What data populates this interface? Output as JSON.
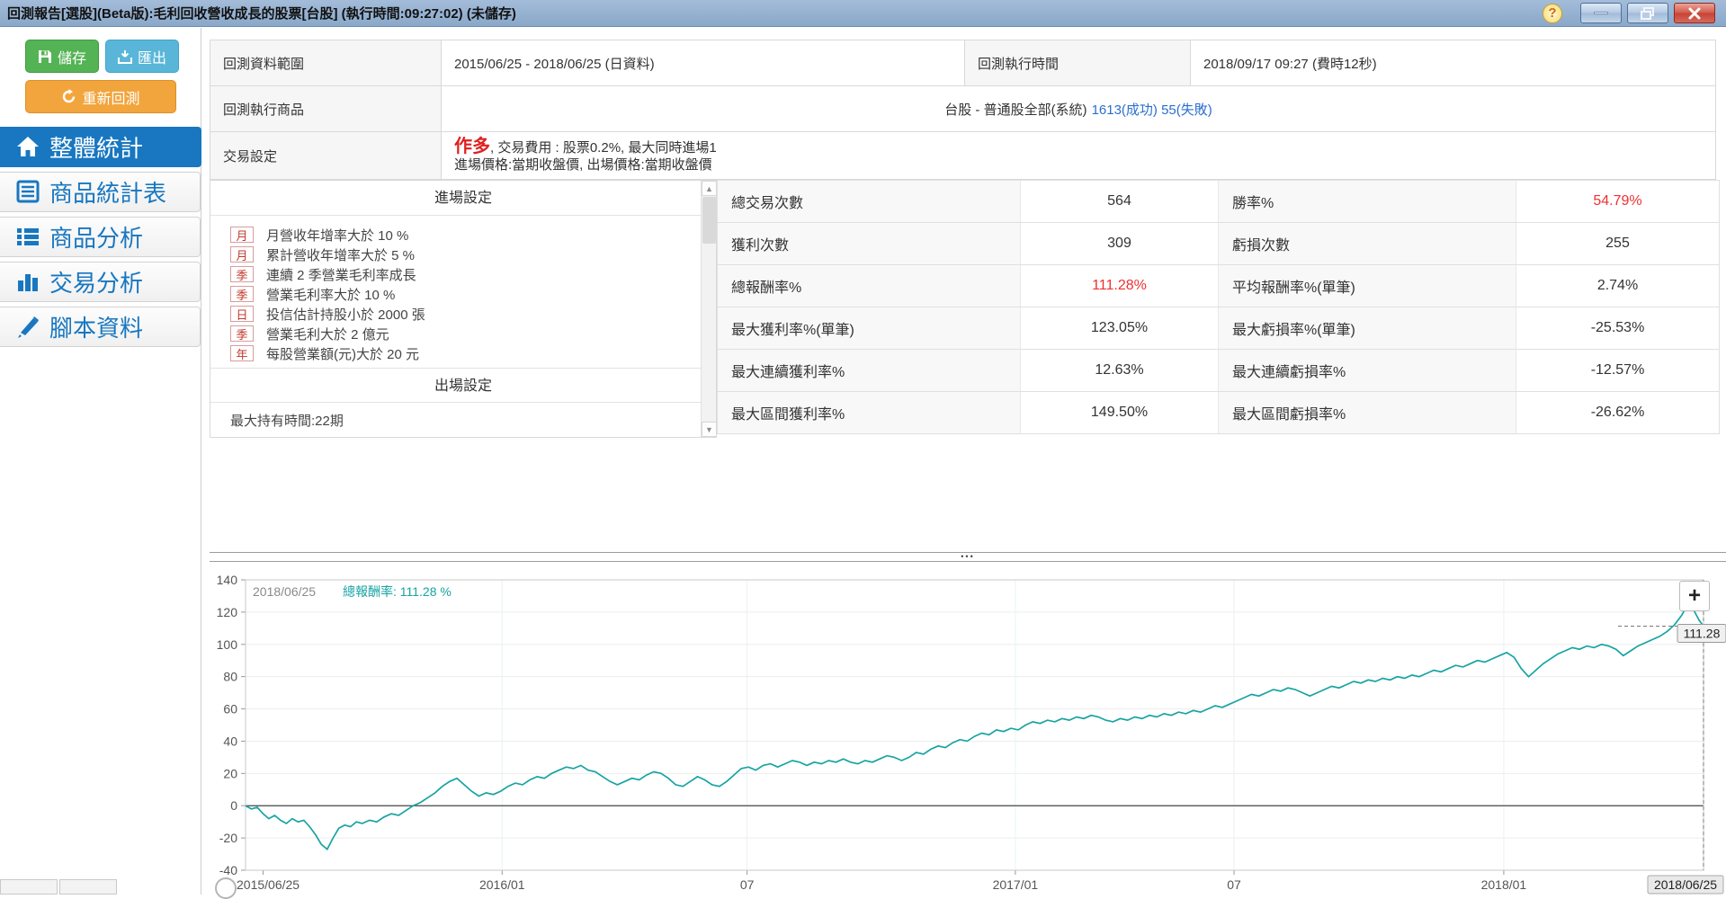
{
  "title_bar": {
    "title": "回測報告[選股](Beta版):毛利回收營收成長的股票[台股] (執行時間:09:27:02) (未儲存)",
    "help_glyph": "?"
  },
  "sidebar": {
    "save_label": "儲存",
    "export_label": "匯出",
    "rerun_label": "重新回測",
    "nav": [
      {
        "label": "整體統計",
        "icon": "home-icon",
        "active": true
      },
      {
        "label": "商品統計表",
        "icon": "table-icon",
        "active": false
      },
      {
        "label": "商品分析",
        "icon": "list-icon",
        "active": false
      },
      {
        "label": "交易分析",
        "icon": "bar-chart-icon",
        "active": false
      },
      {
        "label": "腳本資料",
        "icon": "pencil-icon",
        "active": false
      }
    ]
  },
  "info_table": {
    "range_label": "回測資料範圍",
    "range_value": "2015/06/25 - 2018/06/25 (日資料)",
    "exec_time_label": "回測執行時間",
    "exec_time_value": "2018/09/17 09:27 (費時12秒)",
    "product_label": "回測執行商品",
    "product_value": "台股 - 普通股全部(系統)",
    "product_links": "1613(成功) 55(失敗)",
    "trade_label": "交易設定",
    "trade_long": "作多",
    "trade_line1_rest": ", 交易費用 : 股票0.2%, 最大同時進場1",
    "trade_line2": "進場價格:當期收盤價, 出場價格:當期收盤價"
  },
  "settings_panel": {
    "entry_header": "進場設定",
    "entries": [
      {
        "tag": "月",
        "text": "月營收年增率大於 10 %"
      },
      {
        "tag": "月",
        "text": "累計營收年增率大於 5 %"
      },
      {
        "tag": "季",
        "text": "連續 2 季營業毛利率成長"
      },
      {
        "tag": "季",
        "text": "營業毛利率大於 10 %"
      },
      {
        "tag": "日",
        "text": "投信估計持股小於 2000 張"
      },
      {
        "tag": "季",
        "text": "營業毛利大於 2 億元"
      },
      {
        "tag": "年",
        "text": "每股營業額(元)大於 20 元"
      }
    ],
    "exit_header": "出場設定",
    "exit_partial": "最大持有時間:22期"
  },
  "stats": {
    "rows": [
      [
        {
          "label": "總交易次數",
          "value": "564",
          "red": false
        },
        {
          "label": "勝率%",
          "value": "54.79%",
          "red": true
        }
      ],
      [
        {
          "label": "獲利次數",
          "value": "309",
          "red": false
        },
        {
          "label": "虧損次數",
          "value": "255",
          "red": false
        }
      ],
      [
        {
          "label": "總報酬率%",
          "value": "111.28%",
          "red": true
        },
        {
          "label": "平均報酬率%(單筆)",
          "value": "2.74%",
          "red": false
        }
      ],
      [
        {
          "label": "最大獲利率%(單筆)",
          "value": "123.05%",
          "red": false
        },
        {
          "label": "最大虧損率%(單筆)",
          "value": "-25.53%",
          "red": false
        }
      ],
      [
        {
          "label": "最大連續獲利率%",
          "value": "12.63%",
          "red": false
        },
        {
          "label": "最大連續虧損率%",
          "value": "-12.57%",
          "red": false
        }
      ],
      [
        {
          "label": "最大區間獲利率%",
          "value": "149.50%",
          "red": false
        },
        {
          "label": "最大區間虧損率%",
          "value": "-26.62%",
          "red": false
        }
      ]
    ]
  },
  "splitter_dots": "•••",
  "chart_data": {
    "type": "line",
    "title": "",
    "legend_date": "2018/06/25",
    "legend_series": "總報酬率: 111.28 %",
    "series_name": "總報酬率",
    "line_color": "#18a3a3",
    "ylim": [
      -40,
      140
    ],
    "yticks": [
      -40,
      -20,
      0,
      20,
      40,
      60,
      80,
      100,
      120,
      140
    ],
    "xticks": [
      {
        "label": "2015/06/25",
        "frac": 0.012,
        "grid": false
      },
      {
        "label": "2016/01",
        "frac": 0.176,
        "grid": true
      },
      {
        "label": "07",
        "frac": 0.344,
        "grid": true
      },
      {
        "label": "2017/01",
        "frac": 0.528,
        "grid": true
      },
      {
        "label": "07",
        "frac": 0.678,
        "grid": true
      },
      {
        "label": "2018/01",
        "frac": 0.863,
        "grid": true
      }
    ],
    "crosshair": {
      "x_label": "2018/06/25",
      "y_label": "111.28",
      "y_value": 111.28
    },
    "zoom_button": "+",
    "grid": true,
    "points": [
      [
        0,
        0
      ],
      [
        0.004,
        -2
      ],
      [
        0.008,
        -1
      ],
      [
        0.012,
        -5
      ],
      [
        0.016,
        -8
      ],
      [
        0.02,
        -6
      ],
      [
        0.024,
        -9
      ],
      [
        0.028,
        -11
      ],
      [
        0.032,
        -8
      ],
      [
        0.036,
        -10
      ],
      [
        0.04,
        -9
      ],
      [
        0.044,
        -13
      ],
      [
        0.048,
        -18
      ],
      [
        0.052,
        -24
      ],
      [
        0.056,
        -27
      ],
      [
        0.06,
        -20
      ],
      [
        0.064,
        -14
      ],
      [
        0.068,
        -12
      ],
      [
        0.072,
        -13
      ],
      [
        0.076,
        -10
      ],
      [
        0.08,
        -11
      ],
      [
        0.085,
        -9
      ],
      [
        0.09,
        -10
      ],
      [
        0.095,
        -7
      ],
      [
        0.1,
        -5
      ],
      [
        0.105,
        -6
      ],
      [
        0.11,
        -3
      ],
      [
        0.115,
        0
      ],
      [
        0.12,
        2
      ],
      [
        0.125,
        5
      ],
      [
        0.13,
        8
      ],
      [
        0.135,
        12
      ],
      [
        0.14,
        15
      ],
      [
        0.145,
        17
      ],
      [
        0.15,
        13
      ],
      [
        0.155,
        9
      ],
      [
        0.16,
        6
      ],
      [
        0.165,
        8
      ],
      [
        0.17,
        7
      ],
      [
        0.175,
        9
      ],
      [
        0.18,
        12
      ],
      [
        0.185,
        14
      ],
      [
        0.19,
        13
      ],
      [
        0.195,
        16
      ],
      [
        0.2,
        18
      ],
      [
        0.205,
        17
      ],
      [
        0.21,
        20
      ],
      [
        0.215,
        22
      ],
      [
        0.22,
        24
      ],
      [
        0.225,
        23
      ],
      [
        0.23,
        25
      ],
      [
        0.235,
        22
      ],
      [
        0.24,
        21
      ],
      [
        0.245,
        18
      ],
      [
        0.25,
        15
      ],
      [
        0.255,
        13
      ],
      [
        0.26,
        15
      ],
      [
        0.265,
        17
      ],
      [
        0.27,
        16
      ],
      [
        0.275,
        19
      ],
      [
        0.28,
        21
      ],
      [
        0.285,
        20
      ],
      [
        0.29,
        17
      ],
      [
        0.295,
        13
      ],
      [
        0.3,
        12
      ],
      [
        0.305,
        15
      ],
      [
        0.31,
        18
      ],
      [
        0.315,
        16
      ],
      [
        0.32,
        13
      ],
      [
        0.325,
        12
      ],
      [
        0.33,
        15
      ],
      [
        0.335,
        19
      ],
      [
        0.34,
        23
      ],
      [
        0.345,
        24
      ],
      [
        0.35,
        22
      ],
      [
        0.355,
        25
      ],
      [
        0.36,
        26
      ],
      [
        0.365,
        24
      ],
      [
        0.37,
        26
      ],
      [
        0.375,
        28
      ],
      [
        0.38,
        27
      ],
      [
        0.385,
        25
      ],
      [
        0.39,
        27
      ],
      [
        0.395,
        26
      ],
      [
        0.4,
        28
      ],
      [
        0.405,
        27
      ],
      [
        0.41,
        29
      ],
      [
        0.415,
        27
      ],
      [
        0.42,
        26
      ],
      [
        0.425,
        28
      ],
      [
        0.43,
        27
      ],
      [
        0.435,
        29
      ],
      [
        0.44,
        31
      ],
      [
        0.445,
        30
      ],
      [
        0.45,
        28
      ],
      [
        0.455,
        30
      ],
      [
        0.46,
        33
      ],
      [
        0.465,
        32
      ],
      [
        0.47,
        35
      ],
      [
        0.475,
        37
      ],
      [
        0.48,
        36
      ],
      [
        0.485,
        39
      ],
      [
        0.49,
        41
      ],
      [
        0.495,
        40
      ],
      [
        0.5,
        43
      ],
      [
        0.505,
        45
      ],
      [
        0.51,
        44
      ],
      [
        0.515,
        47
      ],
      [
        0.52,
        46
      ],
      [
        0.525,
        48
      ],
      [
        0.53,
        47
      ],
      [
        0.535,
        50
      ],
      [
        0.54,
        52
      ],
      [
        0.545,
        51
      ],
      [
        0.55,
        53
      ],
      [
        0.555,
        52
      ],
      [
        0.56,
        54
      ],
      [
        0.565,
        53
      ],
      [
        0.57,
        55
      ],
      [
        0.575,
        54
      ],
      [
        0.58,
        56
      ],
      [
        0.585,
        55
      ],
      [
        0.59,
        53
      ],
      [
        0.595,
        52
      ],
      [
        0.6,
        54
      ],
      [
        0.605,
        53
      ],
      [
        0.61,
        55
      ],
      [
        0.615,
        54
      ],
      [
        0.62,
        56
      ],
      [
        0.625,
        55
      ],
      [
        0.63,
        57
      ],
      [
        0.635,
        56
      ],
      [
        0.64,
        58
      ],
      [
        0.645,
        57
      ],
      [
        0.65,
        59
      ],
      [
        0.655,
        58
      ],
      [
        0.66,
        60
      ],
      [
        0.665,
        62
      ],
      [
        0.67,
        61
      ],
      [
        0.675,
        63
      ],
      [
        0.68,
        65
      ],
      [
        0.685,
        67
      ],
      [
        0.69,
        69
      ],
      [
        0.695,
        68
      ],
      [
        0.7,
        70
      ],
      [
        0.705,
        72
      ],
      [
        0.71,
        71
      ],
      [
        0.715,
        73
      ],
      [
        0.72,
        72
      ],
      [
        0.725,
        70
      ],
      [
        0.73,
        68
      ],
      [
        0.735,
        70
      ],
      [
        0.74,
        72
      ],
      [
        0.745,
        74
      ],
      [
        0.75,
        73
      ],
      [
        0.755,
        75
      ],
      [
        0.76,
        77
      ],
      [
        0.765,
        76
      ],
      [
        0.77,
        78
      ],
      [
        0.775,
        77
      ],
      [
        0.78,
        79
      ],
      [
        0.785,
        78
      ],
      [
        0.79,
        80
      ],
      [
        0.795,
        79
      ],
      [
        0.8,
        81
      ],
      [
        0.805,
        80
      ],
      [
        0.81,
        82
      ],
      [
        0.815,
        84
      ],
      [
        0.82,
        83
      ],
      [
        0.825,
        85
      ],
      [
        0.83,
        87
      ],
      [
        0.835,
        86
      ],
      [
        0.84,
        88
      ],
      [
        0.845,
        90
      ],
      [
        0.85,
        89
      ],
      [
        0.855,
        91
      ],
      [
        0.86,
        93
      ],
      [
        0.865,
        95
      ],
      [
        0.87,
        92
      ],
      [
        0.875,
        85
      ],
      [
        0.88,
        80
      ],
      [
        0.885,
        84
      ],
      [
        0.89,
        88
      ],
      [
        0.895,
        91
      ],
      [
        0.9,
        94
      ],
      [
        0.905,
        96
      ],
      [
        0.91,
        98
      ],
      [
        0.915,
        97
      ],
      [
        0.92,
        99
      ],
      [
        0.925,
        98
      ],
      [
        0.93,
        100
      ],
      [
        0.935,
        99
      ],
      [
        0.94,
        97
      ],
      [
        0.945,
        93
      ],
      [
        0.95,
        96
      ],
      [
        0.955,
        99
      ],
      [
        0.96,
        101
      ],
      [
        0.965,
        103
      ],
      [
        0.97,
        105
      ],
      [
        0.975,
        108
      ],
      [
        0.98,
        112
      ],
      [
        0.985,
        118
      ],
      [
        0.988,
        123
      ],
      [
        0.991,
        125
      ],
      [
        0.994,
        120
      ],
      [
        0.997,
        115
      ],
      [
        1,
        111.28
      ]
    ]
  }
}
